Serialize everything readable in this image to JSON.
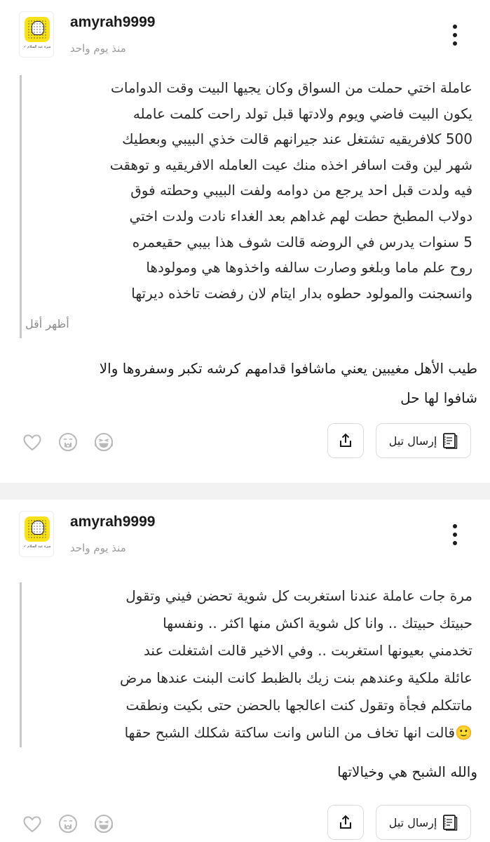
{
  "posts": [
    {
      "username": "amyrah9999",
      "timestamp": "منذ يوم واحد",
      "avatar_caption": "ميرة عبد السلام ✓",
      "quote": "عاملة اختي حملت من السواق وكان يجيها البيت وقت الدوامات\nيكون البيت فاضي ويوم ولادتها قبل تولد راحت كلمت عامله\n500 كلافريقيه تشتغل عند جيرانهم قالت خذي البيبي وبعطيك\nشهر لين وقت اسافر اخذه منك عيت العامله الافريقيه و توهقت\nفيه ولدت قبل احد يرجع من دوامه ولفت البيبي وحطته فوق\nدولاب المطبخ حطت لهم غداهم بعد الغداء نادت ولدت اختي\n5 سنوات يدرس في الروضه قالت شوف هذا بيبي حقيعمره\nروح علم ماما وبلغو وصارت سالفه واخذوها هي ومولودها\nوانسجنت والمولود حطوه بدار ايتام لان رفضت تاخذه ديرتها",
      "show_less": "أظهر أقل",
      "reply": "طيب الأهل مغيبين يعني ماشافوا قدامهم كرشه تكبر وسفروها والا\nشافوا لها حل",
      "tell_label": "إرسال تيل"
    },
    {
      "username": "amyrah9999",
      "timestamp": "منذ يوم واحد",
      "avatar_caption": "ميرة عبد السلام ✓",
      "quote": "مرة جات عاملة عندنا استغربت كل شوية تحضن فيني وتقول\nحبيتك حبيتك .. وانا كل شوية اكش منها اكثر .. ونفسها\nتخدمني بعيونها استغربت .. وفي الاخير قالت اشتغلت عند\nعائلة ملكية وعندهم بنت زيك بالظبط كانت البنت عندها مرض\nماتتكلم فجأة وتقول كنت اعالجها بالحضن حتى بكيت ونطقت\n🙂قالت انها تخاف من الناس وانت ساكتة شكلك الشبح حقها",
      "reply": "والله الشبح هي وخيالاتها",
      "tell_label": "إرسال تيل"
    }
  ],
  "icons": {
    "heart": "heart-outline-icon",
    "cry": "crying-face-icon",
    "laugh": "laughing-face-icon",
    "share": "share-icon",
    "tell": "tell-book-icon",
    "more": "more-vertical-icon"
  },
  "colors": {
    "text": "#1a1a1a",
    "muted": "#9a9a9a",
    "quote_border": "#c8c8c8",
    "separator": "#f2f2f2",
    "button_border": "#dcdcdc"
  }
}
